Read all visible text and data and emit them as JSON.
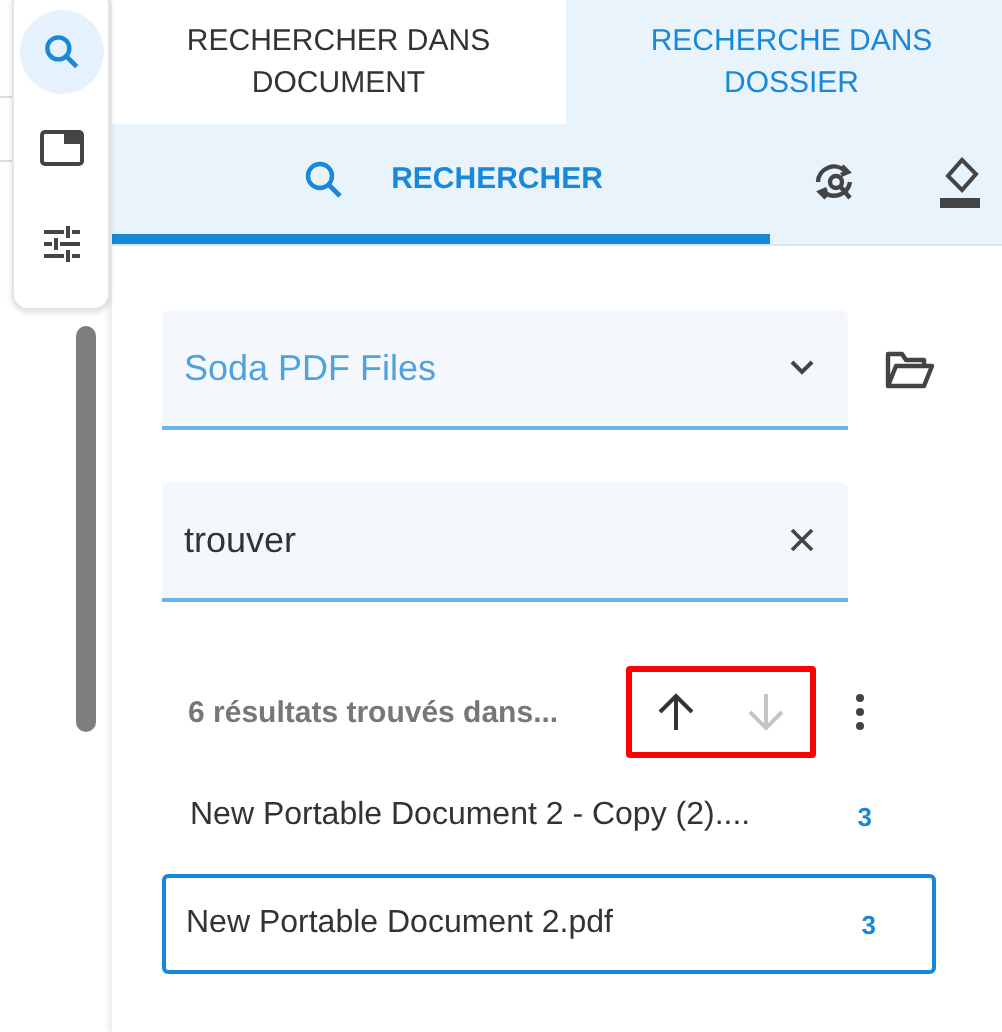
{
  "rail": [
    {
      "kind": "search",
      "selected": true
    },
    {
      "kind": "panel",
      "selected": false
    },
    {
      "kind": "settings",
      "selected": false
    }
  ],
  "tabs": [
    {
      "label": "RECHERCHER DANS DOCUMENT",
      "selected": false
    },
    {
      "label": "RECHERCHE DANS DOSSIER",
      "selected": true
    }
  ],
  "toolbar": {
    "action": "RECHERCHER"
  },
  "folder": {
    "value": "Soda PDF Files"
  },
  "search": {
    "value": "trouver"
  },
  "results": {
    "summary": "6 résultats trouvés dans...",
    "highlighted": true,
    "nav": [
      {
        "kind": "up",
        "disabled": false
      },
      {
        "kind": "down",
        "disabled": true
      }
    ],
    "items": [
      {
        "name": "New Portable Document 2 - Copy (2)....",
        "count": "3",
        "selected": false
      },
      {
        "name": "New Portable Document 2.pdf",
        "count": "3",
        "selected": true
      }
    ]
  }
}
